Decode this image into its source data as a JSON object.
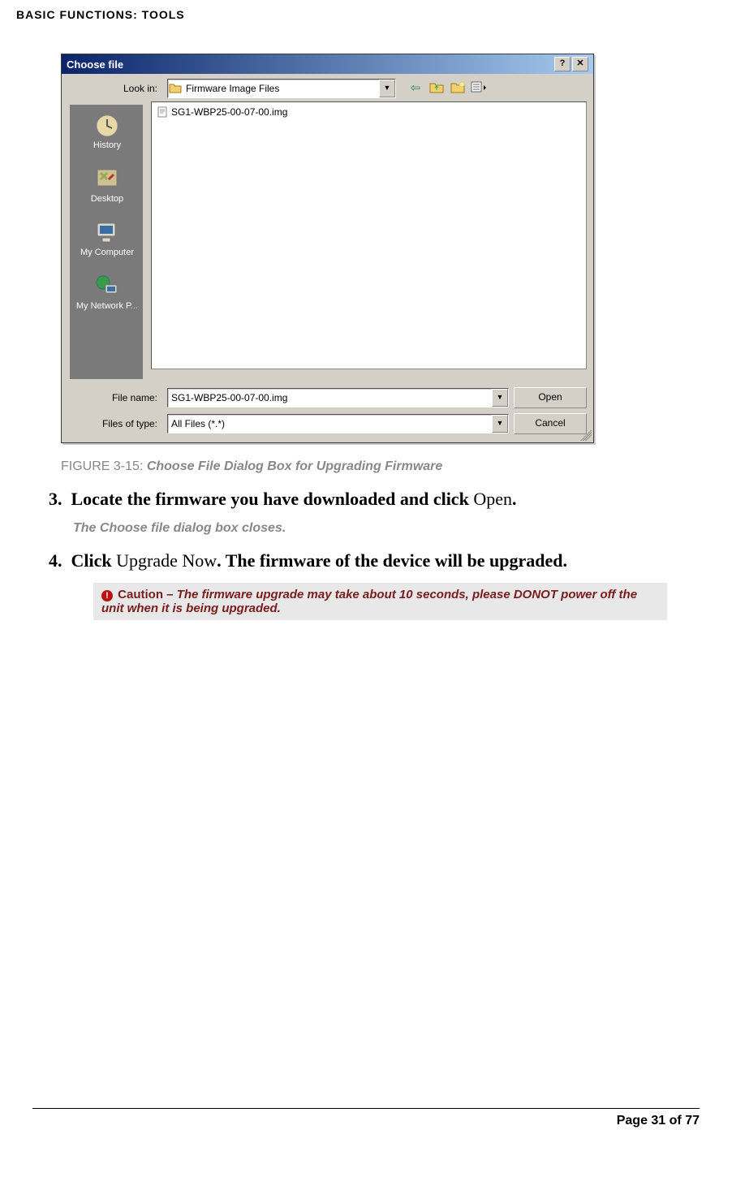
{
  "header": "BASIC FUNCTIONS: TOOLS",
  "dialog": {
    "title": "Choose file",
    "help_btn": "?",
    "close_btn": "✕",
    "look_in_label": "Look in:",
    "look_in_value": "Firmware Image Files",
    "places": [
      "History",
      "Desktop",
      "My Computer",
      "My Network P..."
    ],
    "file_item": "SG1-WBP25-00-07-00.img",
    "file_name_label": "File name:",
    "file_name_value": "SG1-WBP25-00-07-00.img",
    "files_type_label": "Files of type:",
    "files_type_value": "All Files (*.*)",
    "open_btn": "Open",
    "cancel_btn": "Cancel"
  },
  "figure": {
    "label": "FIGURE 3-15:",
    "title": "Choose File Dialog Box for Upgrading Firmware"
  },
  "steps": {
    "s3": {
      "num": "3.",
      "pre": "Locate the firmware you have downloaded and click ",
      "action": "Open",
      "post": "."
    },
    "s3_sub": "The Choose file dialog box closes.",
    "s4": {
      "num": "4.",
      "pre": "Click ",
      "action": "Upgrade Now",
      "post": ". The firmware of the device will be upgraded."
    }
  },
  "caution": {
    "label": "Caution",
    "text": " – The firmware upgrade may take about 10 seconds, please DONOT power off the unit when it is being upgraded."
  },
  "footer": "Page 31 of 77"
}
